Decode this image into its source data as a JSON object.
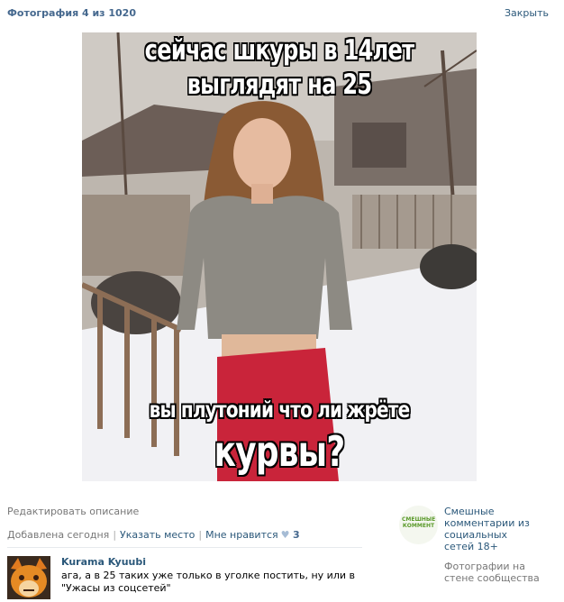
{
  "header": {
    "title": "Фотография 4 из 1020",
    "close_label": "Закрыть"
  },
  "photo": {
    "caption_top_1": "сейчас шкуры в 14лет",
    "caption_top_2": "выглядят на 25",
    "caption_bottom_1": "вы плутоний что ли жрёте",
    "caption_bottom_2": "курвы?"
  },
  "actions": {
    "edit_description": "Редактировать описание",
    "added": "Добавлена сегодня",
    "set_place": "Указать место",
    "like_label": "Мне нравится",
    "like_count": "3"
  },
  "comment": {
    "author": "Kurama Kyuubi",
    "text": "ага, а в 25 таких уже только в уголке постить, ну или в \"Ужасы из соцсетей\""
  },
  "album": {
    "thumb_text": "СМЕШНЫЕ КОММЕНТ",
    "title": "Смешные комментарии из социальных сетей 18+",
    "subtitle": "Фотографии на стене сообщества"
  },
  "colors": {
    "link": "#2b587a",
    "header": "#45688e",
    "muted": "#777777"
  }
}
